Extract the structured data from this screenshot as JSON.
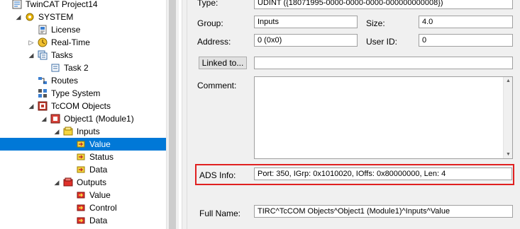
{
  "tree": {
    "items": [
      {
        "label": "TwinCAT Project14",
        "icon": "project-icon",
        "level": 0,
        "expander": ""
      },
      {
        "label": "SYSTEM",
        "icon": "gear-icon",
        "level": 1,
        "expander": "expanded"
      },
      {
        "label": "License",
        "icon": "license-icon",
        "level": 2,
        "expander": ""
      },
      {
        "label": "Real-Time",
        "icon": "realtime-icon",
        "level": 2,
        "expander": "collapsed"
      },
      {
        "label": "Tasks",
        "icon": "tasks-icon",
        "level": 2,
        "expander": "expanded"
      },
      {
        "label": "Task 2",
        "icon": "task-icon",
        "level": 3,
        "expander": ""
      },
      {
        "label": "Routes",
        "icon": "routes-icon",
        "level": 2,
        "expander": ""
      },
      {
        "label": "Type System",
        "icon": "type-system-icon",
        "level": 2,
        "expander": ""
      },
      {
        "label": "TcCOM Objects",
        "icon": "tccom-icon",
        "level": 2,
        "expander": "expanded"
      },
      {
        "label": "Object1 (Module1)",
        "icon": "module-icon",
        "level": 3,
        "expander": "expanded"
      },
      {
        "label": "Inputs",
        "icon": "inputs-folder-icon",
        "level": 4,
        "expander": "expanded"
      },
      {
        "label": "Value",
        "icon": "input-variable-icon",
        "level": 5,
        "expander": "",
        "selected": true
      },
      {
        "label": "Status",
        "icon": "input-variable-icon",
        "level": 5,
        "expander": ""
      },
      {
        "label": "Data",
        "icon": "input-variable-icon",
        "level": 5,
        "expander": ""
      },
      {
        "label": "Outputs",
        "icon": "outputs-folder-icon",
        "level": 4,
        "expander": "expanded"
      },
      {
        "label": "Value",
        "icon": "output-variable-icon",
        "level": 5,
        "expander": ""
      },
      {
        "label": "Control",
        "icon": "output-variable-icon",
        "level": 5,
        "expander": ""
      },
      {
        "label": "Data",
        "icon": "output-variable-icon",
        "level": 5,
        "expander": ""
      }
    ]
  },
  "properties": {
    "type_label": "Type:",
    "type_value": "UDINT ({18071995-0000-0000-0000-000000000008})",
    "group_label": "Group:",
    "group_value": "Inputs",
    "size_label": "Size:",
    "size_value": "4.0",
    "address_label": "Address:",
    "address_value": "0 (0x0)",
    "user_id_label": "User ID:",
    "user_id_value": "0",
    "linked_button": "Linked to...",
    "linked_value": "",
    "comment_label": "Comment:",
    "comment_value": "",
    "ads_label": "ADS Info:",
    "ads_value": "Port: 350, IGrp: 0x1010020, IOffs: 0x80000000, Len: 4",
    "fullname_label": "Full Name:",
    "fullname_value": "TIRC^TcCOM Objects^Object1 (Module1)^Inputs^Value"
  },
  "colors": {
    "selection": "#0078d7",
    "highlight_border": "#e02020",
    "panel_bg": "#f0f0f0"
  }
}
